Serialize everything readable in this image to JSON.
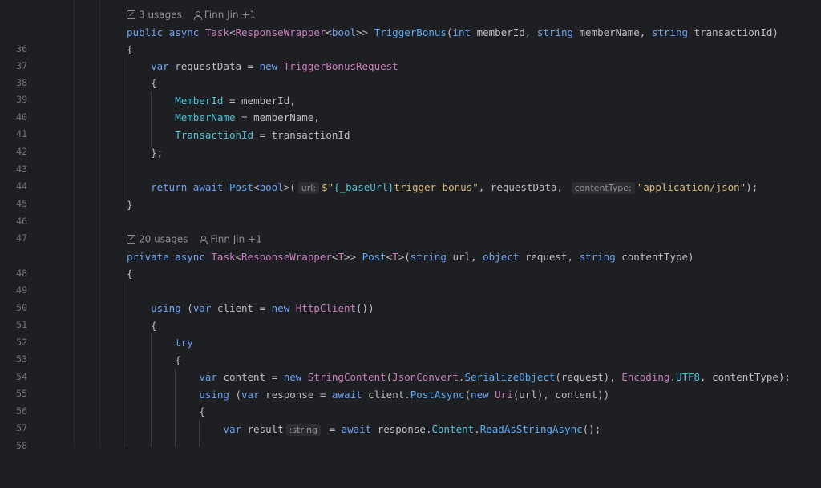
{
  "lens1": {
    "usages": "3 usages",
    "author": "Finn Jin +1"
  },
  "lens2": {
    "usages": "20 usages",
    "author": "Finn Jin +1"
  },
  "line_numbers": [
    "36",
    "37",
    "38",
    "39",
    "40",
    "41",
    "42",
    "43",
    "44",
    "45",
    "46",
    "47",
    "48",
    "49",
    "50",
    "51",
    "52",
    "53",
    "54",
    "55",
    "56",
    "57",
    "58"
  ],
  "hints": {
    "url": "url:",
    "contentType": "contentType:",
    "string": ":string"
  },
  "code": {
    "l36": {
      "pub": "public",
      "async": "async",
      "task": "Task",
      "rw": "ResponseWrapper",
      "bool": "bool",
      "name": "TriggerBonus",
      "int": "int",
      "p1": "memberId",
      "str1": "string",
      "p2": "memberName",
      "str2": "string",
      "p3": "transactionId"
    },
    "l38": {
      "var": "var",
      "name": "requestData",
      "new": "new",
      "type": "TriggerBonusRequest"
    },
    "l40": {
      "prop": "MemberId",
      "val": "memberId"
    },
    "l41": {
      "prop": "MemberName",
      "val": "memberName"
    },
    "l42": {
      "prop": "TransactionId",
      "val": "transactionId"
    },
    "l45": {
      "ret": "return",
      "await": "await",
      "post": "Post",
      "bool": "bool",
      "str_a": "$\"",
      "interp": "{_baseUrl}",
      "str_b": "trigger-bonus\"",
      "arg": "requestData",
      "ct": "\"application/json\""
    },
    "l48": {
      "priv": "private",
      "async": "async",
      "task": "Task",
      "rw": "ResponseWrapper",
      "T": "T",
      "name": "Post",
      "str1": "string",
      "p1": "url",
      "obj": "object",
      "p2": "request",
      "str2": "string",
      "p3": "contentType"
    },
    "l51": {
      "using": "using",
      "var": "var",
      "name": "client",
      "new": "new",
      "type": "HttpClient"
    },
    "l53": {
      "try": "try"
    },
    "l55": {
      "var": "var",
      "name": "content",
      "new": "new",
      "type": "StringContent",
      "jc": "JsonConvert",
      "ser": "SerializeObject",
      "arg": "request",
      "enc": "Encoding",
      "utf": "UTF8",
      "ct": "contentType"
    },
    "l56": {
      "using": "using",
      "var": "var",
      "name": "response",
      "await": "await",
      "client": "client",
      "post": "PostAsync",
      "new": "new",
      "uri": "Uri",
      "url": "url",
      "content": "content"
    },
    "l58": {
      "var": "var",
      "name": "result",
      "await": "await",
      "resp": "response",
      "content": "Content",
      "read": "ReadAsStringAsync"
    }
  }
}
